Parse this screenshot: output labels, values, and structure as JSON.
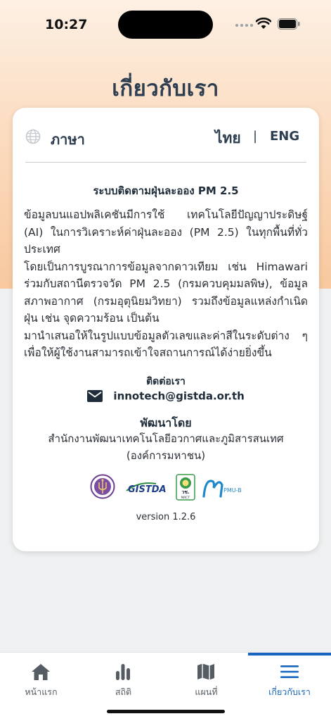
{
  "status_bar": {
    "time": "10:27"
  },
  "page": {
    "title": "เกี่ยวกับเรา"
  },
  "language": {
    "label": "ภาษา",
    "thai": "ไทย",
    "separator": "|",
    "english": "ENG"
  },
  "about": {
    "system_title": "ระบบติดตามฝุ่นละออง PM 2.5",
    "paragraphs": [
      "ข้อมูลบนแอปพลิเคชันมีการใช้ เทคโนโลยีปัญญาประดิษฐ์ (AI) ในการวิเคราะห์ค่าฝุ่นละออง (PM 2.5) ในทุกพื้นที่ทั่วประเทศ",
      "โดยเป็นการบูรณาการข้อมูลจากดาวเทียม เช่น Himawari ร่วมกับสถานีตรวจวัด PM 2.5 (กรมควบคุมมลพิษ), ข้อมูลสภาพอากาศ (กรมอุตุนิยมวิทยา) รวมถึงข้อมูลแหล่งกำเนิดฝุ่น เช่น จุดความร้อน เป็นต้น",
      "มานำเสนอให้ในรูปแบบข้อมูลตัวเลขและค่าสีในระดับต่าง ๆ เพื่อให้ผู้ใช้งานสามารถเข้าใจสถานการณ์ได้ง่ายยิ่งขึ้น"
    ]
  },
  "contact": {
    "heading": "ติดต่อเรา",
    "email": "innotech@gistda.or.th"
  },
  "developer": {
    "heading": "พัฒนาโดย",
    "org_line1": "สำนักงานพัฒนาเทคโนโลยีอวกาศและภูมิสารสนเทศ",
    "org_line2": "(องค์การมหาชน)"
  },
  "logos": {
    "gistda": "GISTDA",
    "nrct": "วช.",
    "nrct_sub": "NRCT",
    "pmub": "PMU-B"
  },
  "version": "version 1.2.6",
  "tabs": [
    {
      "label": "หน้าแรก",
      "icon": "home-icon",
      "active": false
    },
    {
      "label": "สถิติ",
      "icon": "bar-chart-icon",
      "active": false
    },
    {
      "label": "แผนที่",
      "icon": "map-icon",
      "active": false
    },
    {
      "label": "เกี่ยวกับเรา",
      "icon": "menu-icon",
      "active": true
    }
  ],
  "colors": {
    "accent": "#1565c0",
    "title": "#2c3e50",
    "header_gradient_top": "#fdf0e4",
    "header_gradient_bottom": "#f8c89e"
  }
}
